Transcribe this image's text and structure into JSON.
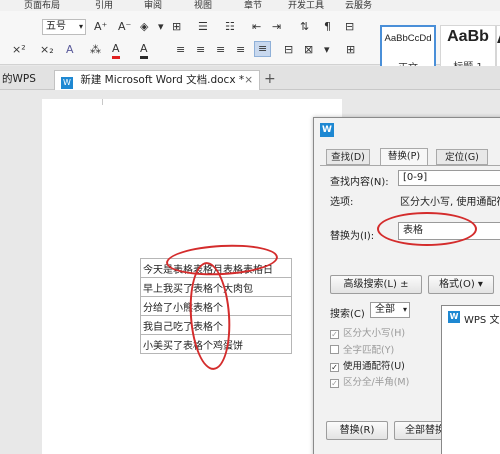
{
  "menubar": {
    "items": [
      "页面布局",
      "引用",
      "审阅",
      "视图",
      "章节",
      "开发工具",
      "云服务"
    ]
  },
  "toolbar": {
    "font_size": "五号",
    "font_size_icons": [
      "A⁺",
      "A⁻",
      "◈",
      "▾"
    ],
    "format_icons": [
      "×²",
      "×₂",
      "A",
      "⁂",
      "A",
      "A"
    ],
    "para_icons": [
      "≡",
      "≡",
      "≡",
      "≡",
      "≡",
      "⊟",
      "⊠"
    ],
    "styles": [
      {
        "preview": "AaBbCcDd",
        "label": "正文"
      },
      {
        "preview": "AaBb",
        "label": "标题 1"
      },
      {
        "preview": "A",
        "label": ""
      }
    ]
  },
  "tabs": [
    {
      "label": "的WPS"
    },
    {
      "label": "新建 Microsoft Word 文档.docx *",
      "active": true
    }
  ],
  "tab_close": "×",
  "tab_add": "+",
  "table_rows": [
    "今天是表格表格月表格表格日",
    "早上我买了表格个大肉包",
    "分给了小熊表格个",
    "我自己吃了表格个",
    "小美买了表格个鸡蛋饼"
  ],
  "dialog": {
    "icon": "W",
    "tabs": [
      "查找(D)",
      "替换(P)",
      "定位(G)"
    ],
    "find_label": "查找内容(N):",
    "find_value": "[0-9]",
    "options_label": "选项:",
    "options_value": "区分大小写, 使用通配符",
    "replace_label": "替换为(I):",
    "replace_value": "表格",
    "advanced_btn": "高级搜索(L) ±",
    "format_btn": "格式(O) ▾",
    "search_label": "搜索(C)",
    "search_value": "全部",
    "options": [
      {
        "label": "区分大小写(H)",
        "checked": true,
        "disabled": true
      },
      {
        "label": "全字匹配(Y)",
        "checked": false,
        "disabled": true
      },
      {
        "label": "使用通配符(U)",
        "checked": true,
        "disabled": false
      },
      {
        "label": "区分全/半角(M)",
        "checked": true,
        "disabled": true
      }
    ],
    "replace_btn": "替换(R)",
    "replace_all_btn": "全部替换"
  },
  "popup": {
    "title": "WPS 文"
  },
  "colors": {
    "annotation": "#d42c2c",
    "wps_blue": "#1e88d2",
    "active_style_border": "#4a8fd8"
  }
}
